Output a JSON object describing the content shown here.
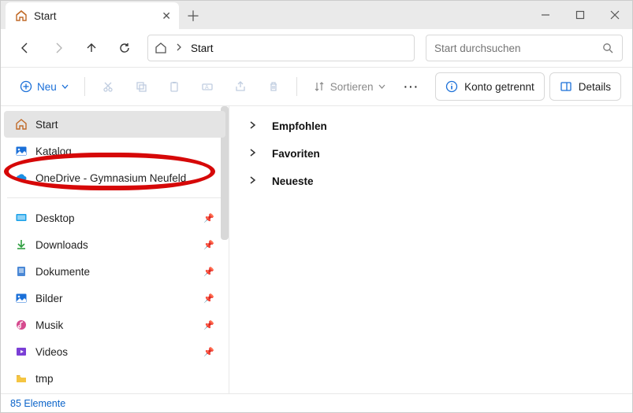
{
  "titlebar": {
    "tab_title": "Start"
  },
  "nav": {
    "crumb": "Start"
  },
  "search": {
    "placeholder": "Start durchsuchen"
  },
  "toolbar": {
    "new_label": "Neu",
    "sort_label": "Sortieren",
    "more_label": "···",
    "account_label": "Konto getrennt",
    "details_label": "Details"
  },
  "sidebar": {
    "top": [
      {
        "label": "Start"
      },
      {
        "label": "Katalog"
      },
      {
        "label": "OneDrive - Gymnasium Neufeld"
      }
    ],
    "pinned": [
      {
        "label": "Desktop"
      },
      {
        "label": "Downloads"
      },
      {
        "label": "Dokumente"
      },
      {
        "label": "Bilder"
      },
      {
        "label": "Musik"
      },
      {
        "label": "Videos"
      },
      {
        "label": "tmp"
      }
    ]
  },
  "content": {
    "sections": [
      {
        "label": "Empfohlen"
      },
      {
        "label": "Favoriten"
      },
      {
        "label": "Neueste"
      }
    ]
  },
  "status": {
    "count_text": "85 Elemente"
  }
}
